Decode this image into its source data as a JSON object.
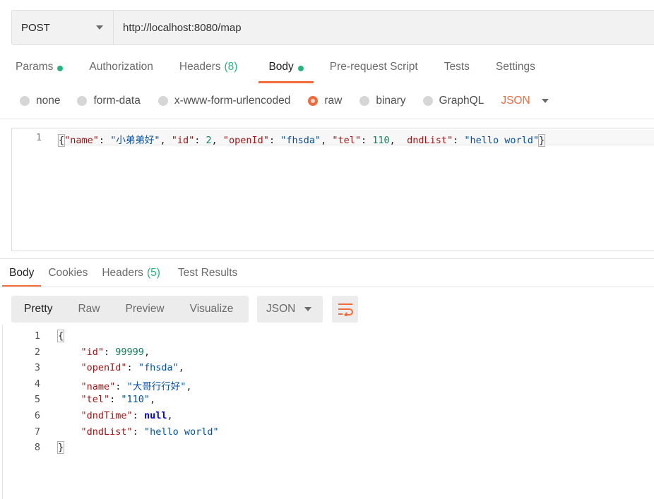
{
  "request": {
    "method": "POST",
    "url": "http://localhost:8080/map"
  },
  "request_tabs": [
    {
      "label": "Params",
      "dot": true
    },
    {
      "label": "Authorization"
    },
    {
      "label": "Headers",
      "count": "(8)"
    },
    {
      "label": "Body",
      "dot": true,
      "active": true
    },
    {
      "label": "Pre-request Script"
    },
    {
      "label": "Tests"
    },
    {
      "label": "Settings"
    }
  ],
  "body_types": [
    {
      "label": "none"
    },
    {
      "label": "form-data"
    },
    {
      "label": "x-www-form-urlencoded"
    },
    {
      "label": "raw",
      "selected": true
    },
    {
      "label": "binary"
    },
    {
      "label": "GraphQL"
    }
  ],
  "body_language": "JSON",
  "request_body": {
    "line_number": "1",
    "fields": [
      {
        "key": "\"name\"",
        "value": "\"小弟弟好\"",
        "type": "string"
      },
      {
        "key": "\"id\"",
        "value": "2",
        "type": "number"
      },
      {
        "key": "\"openId\"",
        "value": "\"fhsda\"",
        "type": "string"
      },
      {
        "key": "\"tel\"",
        "value": "110",
        "type": "number"
      },
      {
        "key": "dndList\"",
        "value": "\"hello world\"",
        "type": "string"
      }
    ]
  },
  "response_tabs": [
    {
      "label": "Body",
      "active": true
    },
    {
      "label": "Cookies"
    },
    {
      "label": "Headers",
      "count": "(5)"
    },
    {
      "label": "Test Results"
    }
  ],
  "view_modes": [
    "Pretty",
    "Raw",
    "Preview",
    "Visualize"
  ],
  "response_format": "JSON",
  "response_body": [
    {
      "n": "1",
      "key": "",
      "value": "",
      "type": "open"
    },
    {
      "n": "2",
      "key": "\"id\"",
      "value": "99999",
      "type": "number",
      "comma": true
    },
    {
      "n": "3",
      "key": "\"openId\"",
      "value": "\"fhsda\"",
      "type": "string",
      "comma": true
    },
    {
      "n": "4",
      "key": "\"name\"",
      "value": "\"大哥行行好\"",
      "type": "string",
      "comma": true
    },
    {
      "n": "5",
      "key": "\"tel\"",
      "value": "\"110\"",
      "type": "string",
      "comma": true
    },
    {
      "n": "6",
      "key": "\"dndTime\"",
      "value": "null",
      "type": "null",
      "comma": true
    },
    {
      "n": "7",
      "key": "\"dndList\"",
      "value": "\"hello world\"",
      "type": "string",
      "comma": false
    },
    {
      "n": "8",
      "key": "",
      "value": "",
      "type": "close"
    }
  ],
  "colors": {
    "accent": "#f26b3a",
    "dot_green": "#26b47f",
    "json_key": "#a31515",
    "json_string": "#0451a5",
    "json_number": "#098658",
    "json_null": "#0000ff"
  }
}
